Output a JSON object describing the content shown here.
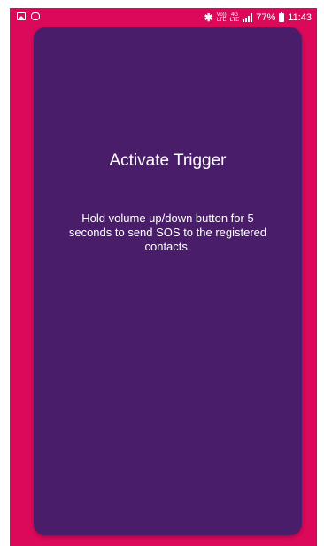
{
  "status_bar": {
    "left_icons": [
      "gallery-icon",
      "chat-icon"
    ],
    "bluetooth_icon": "bluetooth-icon",
    "volte_top": "Vo))",
    "volte_bottom": "LTE",
    "network_top": "4G",
    "network_bottom": "LTE",
    "battery_percent": "77%",
    "time": "11:43"
  },
  "card": {
    "title": "Activate Trigger",
    "description": "Hold volume up/down button for 5 seconds to send SOS to the registered contacts."
  },
  "colors": {
    "background": "#dc0859",
    "card": "#4a1d6b",
    "text": "#ffffff"
  }
}
